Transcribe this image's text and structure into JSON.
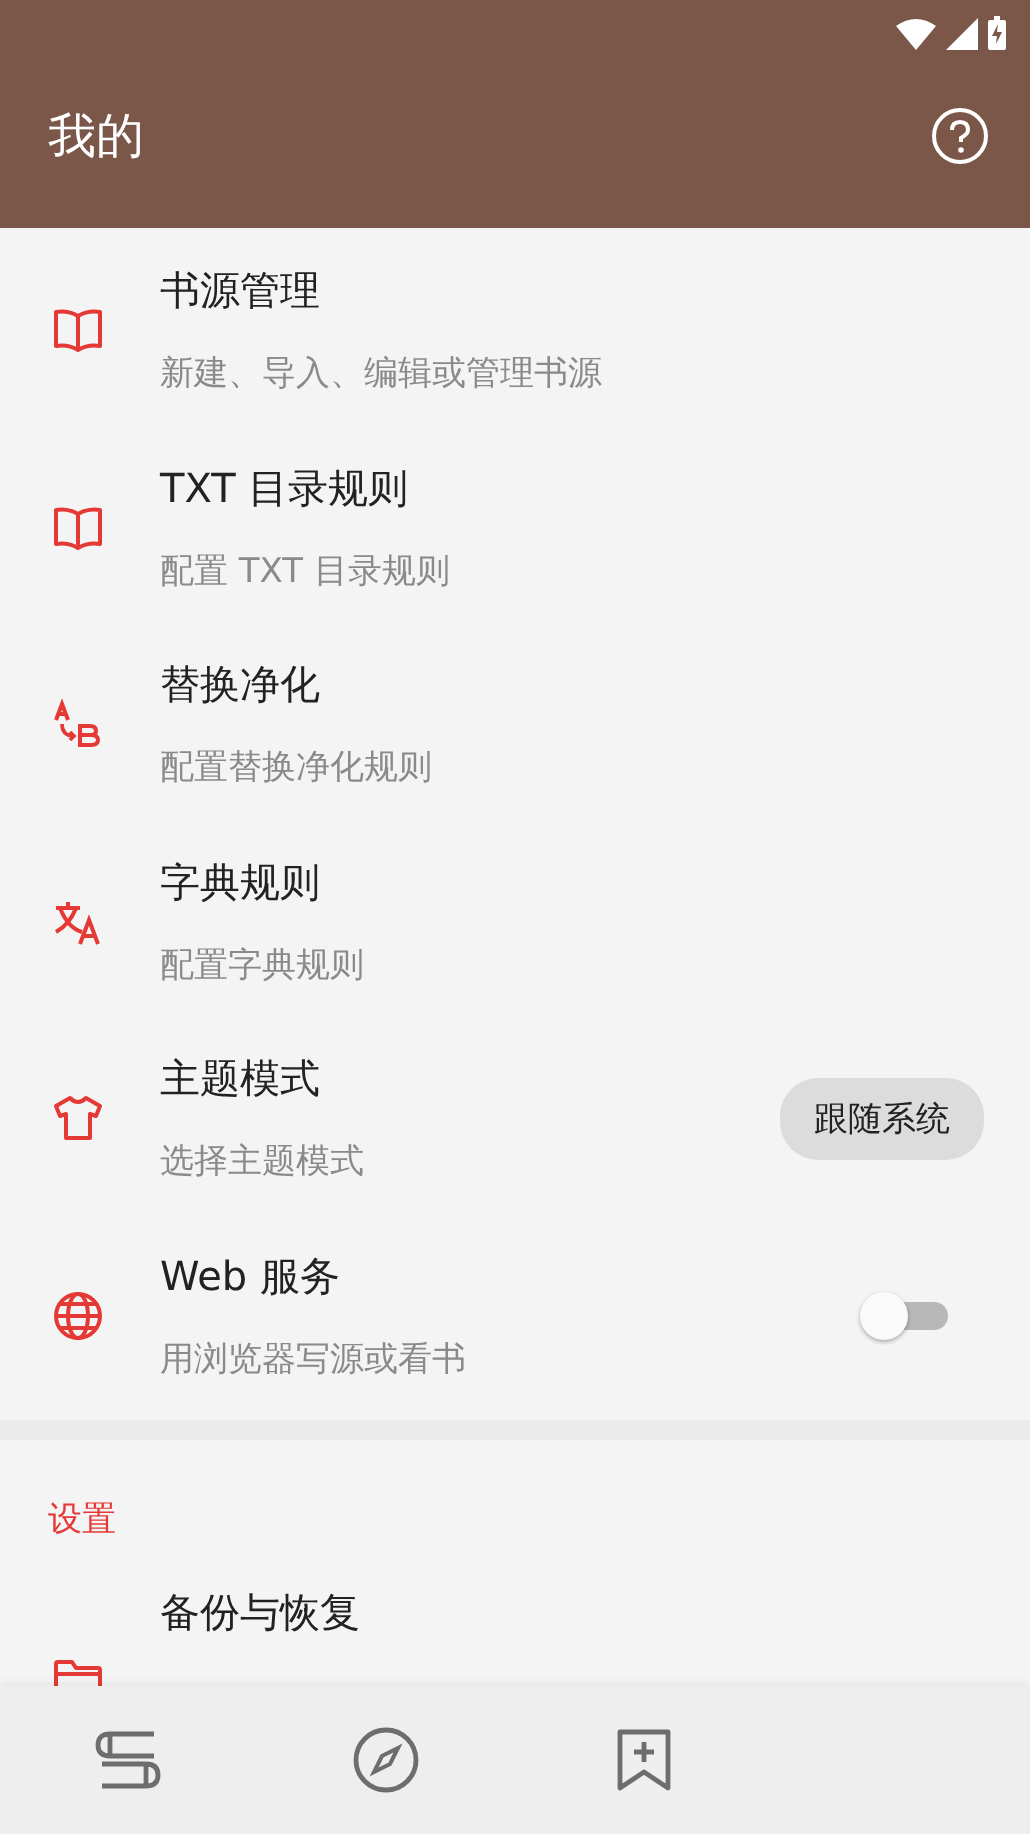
{
  "app_bar": {
    "title": "我的"
  },
  "items": [
    {
      "kind": "plain",
      "title": "书源管理",
      "subtitle": "新建、导入、编辑或管理书源"
    },
    {
      "kind": "plain",
      "title": "TXT 目录规则",
      "subtitle": "配置 TXT 目录规则"
    },
    {
      "kind": "plain",
      "title": "替换净化",
      "subtitle": "配置替换净化规则"
    },
    {
      "kind": "plain",
      "title": "字典规则",
      "subtitle": "配置字典规则"
    },
    {
      "kind": "choice",
      "title": "主题模式",
      "subtitle": "选择主题模式",
      "value": "跟随系统"
    },
    {
      "kind": "switch",
      "title": "Web 服务",
      "subtitle": "用浏览器写源或看书",
      "on": false
    }
  ],
  "settings": {
    "header": "设置",
    "items": [
      {
        "title": "备份与恢复"
      }
    ]
  }
}
